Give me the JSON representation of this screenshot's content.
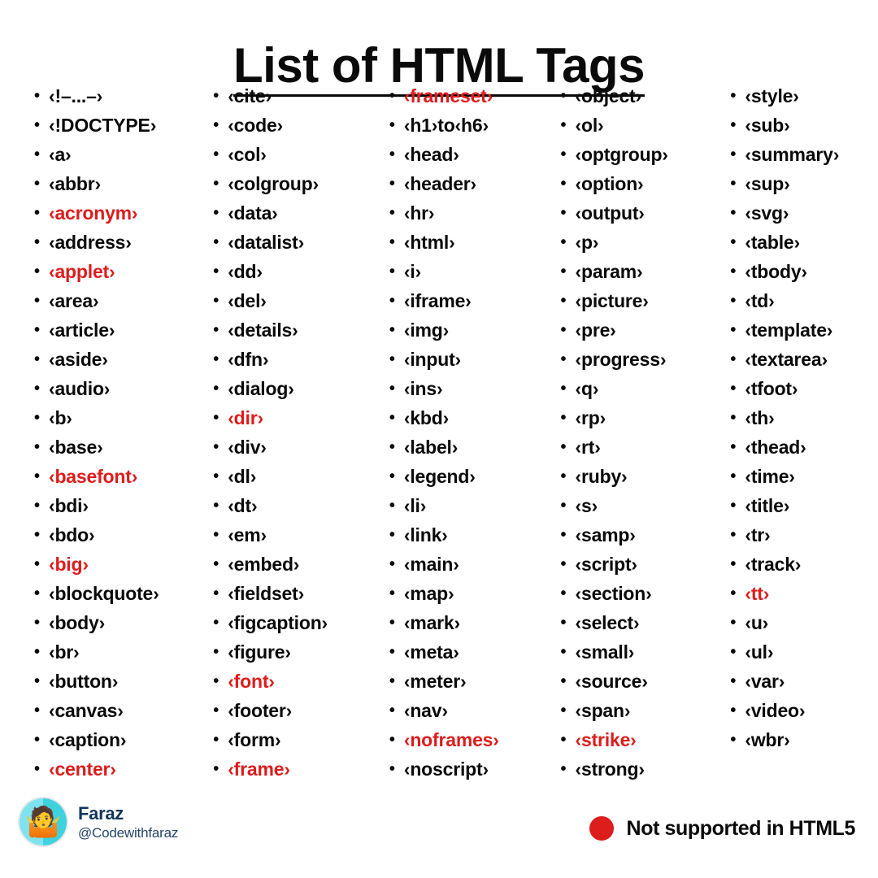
{
  "title": "List of HTML Tags",
  "colors": {
    "deprecated": "#DD1C1C",
    "text": "#0A0A0A",
    "author_name": "#12365C",
    "author_handle": "#23456B",
    "avatar_bg": "#5FDCE8"
  },
  "legend": {
    "dot_color": "#DD1C1C",
    "label": "Not supported in HTML5"
  },
  "author": {
    "avatar_icon": "shrug-person-emoji",
    "avatar_glyph": "🤷",
    "name": "Faraz",
    "handle": "@Codewithfaraz"
  },
  "bullet_glyph": "•",
  "columns": [
    {
      "index": 0,
      "items": [
        {
          "label": "‹!–...–›",
          "deprecated": false
        },
        {
          "label": "‹!DOCTYPE›",
          "deprecated": false
        },
        {
          "label": "‹a›",
          "deprecated": false
        },
        {
          "label": "‹abbr›",
          "deprecated": false
        },
        {
          "label": "‹acronym›",
          "deprecated": true
        },
        {
          "label": "‹address›",
          "deprecated": false
        },
        {
          "label": "‹applet›",
          "deprecated": true
        },
        {
          "label": "‹area›",
          "deprecated": false
        },
        {
          "label": "‹article›",
          "deprecated": false
        },
        {
          "label": "‹aside›",
          "deprecated": false
        },
        {
          "label": "‹audio›",
          "deprecated": false
        },
        {
          "label": "‹b›",
          "deprecated": false
        },
        {
          "label": "‹base›",
          "deprecated": false
        },
        {
          "label": "‹basefont›",
          "deprecated": true
        },
        {
          "label": "‹bdi›",
          "deprecated": false
        },
        {
          "label": "‹bdo›",
          "deprecated": false
        },
        {
          "label": "‹big›",
          "deprecated": true
        },
        {
          "label": "‹blockquote›",
          "deprecated": false
        },
        {
          "label": "‹body›",
          "deprecated": false
        },
        {
          "label": "‹br›",
          "deprecated": false
        },
        {
          "label": "‹button›",
          "deprecated": false
        },
        {
          "label": "‹canvas›",
          "deprecated": false
        },
        {
          "label": "‹caption›",
          "deprecated": false
        },
        {
          "label": "‹center›",
          "deprecated": true
        }
      ]
    },
    {
      "index": 1,
      "items": [
        {
          "label": "‹cite›",
          "deprecated": false
        },
        {
          "label": "‹code›",
          "deprecated": false
        },
        {
          "label": "‹col›",
          "deprecated": false
        },
        {
          "label": "‹colgroup›",
          "deprecated": false
        },
        {
          "label": "‹data›",
          "deprecated": false
        },
        {
          "label": "‹datalist›",
          "deprecated": false
        },
        {
          "label": "‹dd›",
          "deprecated": false
        },
        {
          "label": "‹del›",
          "deprecated": false
        },
        {
          "label": "‹details›",
          "deprecated": false
        },
        {
          "label": "‹dfn›",
          "deprecated": false
        },
        {
          "label": "‹dialog›",
          "deprecated": false
        },
        {
          "label": "‹dir›",
          "deprecated": true
        },
        {
          "label": "‹div›",
          "deprecated": false
        },
        {
          "label": "‹dl›",
          "deprecated": false
        },
        {
          "label": "‹dt›",
          "deprecated": false
        },
        {
          "label": "‹em›",
          "deprecated": false
        },
        {
          "label": "‹embed›",
          "deprecated": false
        },
        {
          "label": "‹fieldset›",
          "deprecated": false
        },
        {
          "label": "‹figcaption›",
          "deprecated": false
        },
        {
          "label": "‹figure›",
          "deprecated": false
        },
        {
          "label": "‹font›",
          "deprecated": true
        },
        {
          "label": "‹footer›",
          "deprecated": false
        },
        {
          "label": "‹form›",
          "deprecated": false
        },
        {
          "label": "‹frame›",
          "deprecated": true
        }
      ]
    },
    {
      "index": 2,
      "items": [
        {
          "label": "‹frameset›",
          "deprecated": true
        },
        {
          "label": "‹h1›to‹h6›",
          "deprecated": false
        },
        {
          "label": "‹head›",
          "deprecated": false
        },
        {
          "label": "‹header›",
          "deprecated": false
        },
        {
          "label": "‹hr›",
          "deprecated": false
        },
        {
          "label": "‹html›",
          "deprecated": false
        },
        {
          "label": "‹i›",
          "deprecated": false
        },
        {
          "label": "‹iframe›",
          "deprecated": false
        },
        {
          "label": "‹img›",
          "deprecated": false
        },
        {
          "label": "‹input›",
          "deprecated": false
        },
        {
          "label": "‹ins›",
          "deprecated": false
        },
        {
          "label": "‹kbd›",
          "deprecated": false
        },
        {
          "label": "‹label›",
          "deprecated": false
        },
        {
          "label": "‹legend›",
          "deprecated": false
        },
        {
          "label": "‹li›",
          "deprecated": false
        },
        {
          "label": "‹link›",
          "deprecated": false
        },
        {
          "label": "‹main›",
          "deprecated": false
        },
        {
          "label": "‹map›",
          "deprecated": false
        },
        {
          "label": "‹mark›",
          "deprecated": false
        },
        {
          "label": "‹meta›",
          "deprecated": false
        },
        {
          "label": "‹meter›",
          "deprecated": false
        },
        {
          "label": "‹nav›",
          "deprecated": false
        },
        {
          "label": "‹noframes›",
          "deprecated": true
        },
        {
          "label": "‹noscript›",
          "deprecated": false
        }
      ]
    },
    {
      "index": 3,
      "items": [
        {
          "label": "‹object›",
          "deprecated": false
        },
        {
          "label": "‹ol›",
          "deprecated": false
        },
        {
          "label": "‹optgroup›",
          "deprecated": false
        },
        {
          "label": "‹option›",
          "deprecated": false
        },
        {
          "label": "‹output›",
          "deprecated": false
        },
        {
          "label": "‹p›",
          "deprecated": false
        },
        {
          "label": "‹param›",
          "deprecated": false
        },
        {
          "label": "‹picture›",
          "deprecated": false
        },
        {
          "label": "‹pre›",
          "deprecated": false
        },
        {
          "label": "‹progress›",
          "deprecated": false
        },
        {
          "label": "‹q›",
          "deprecated": false
        },
        {
          "label": "‹rp›",
          "deprecated": false
        },
        {
          "label": "‹rt›",
          "deprecated": false
        },
        {
          "label": "‹ruby›",
          "deprecated": false
        },
        {
          "label": "‹s›",
          "deprecated": false
        },
        {
          "label": "‹samp›",
          "deprecated": false
        },
        {
          "label": "‹script›",
          "deprecated": false
        },
        {
          "label": "‹section›",
          "deprecated": false
        },
        {
          "label": "‹select›",
          "deprecated": false
        },
        {
          "label": "‹small›",
          "deprecated": false
        },
        {
          "label": "‹source›",
          "deprecated": false
        },
        {
          "label": "‹span›",
          "deprecated": false
        },
        {
          "label": "‹strike›",
          "deprecated": true
        },
        {
          "label": "‹strong›",
          "deprecated": false
        }
      ]
    },
    {
      "index": 4,
      "items": [
        {
          "label": "‹style›",
          "deprecated": false
        },
        {
          "label": "‹sub›",
          "deprecated": false
        },
        {
          "label": "‹summary›",
          "deprecated": false
        },
        {
          "label": "‹sup›",
          "deprecated": false
        },
        {
          "label": "‹svg›",
          "deprecated": false
        },
        {
          "label": "‹table›",
          "deprecated": false
        },
        {
          "label": "‹tbody›",
          "deprecated": false
        },
        {
          "label": "‹td›",
          "deprecated": false
        },
        {
          "label": "‹template›",
          "deprecated": false
        },
        {
          "label": "‹textarea›",
          "deprecated": false
        },
        {
          "label": "‹tfoot›",
          "deprecated": false
        },
        {
          "label": "‹th›",
          "deprecated": false
        },
        {
          "label": "‹thead›",
          "deprecated": false
        },
        {
          "label": "‹time›",
          "deprecated": false
        },
        {
          "label": "‹title›",
          "deprecated": false
        },
        {
          "label": "‹tr›",
          "deprecated": false
        },
        {
          "label": "‹track›",
          "deprecated": false
        },
        {
          "label": "‹tt›",
          "deprecated": true
        },
        {
          "label": "‹u›",
          "deprecated": false
        },
        {
          "label": "‹ul›",
          "deprecated": false
        },
        {
          "label": "‹var›",
          "deprecated": false
        },
        {
          "label": "‹video›",
          "deprecated": false
        },
        {
          "label": "‹wbr›",
          "deprecated": false
        }
      ]
    }
  ]
}
